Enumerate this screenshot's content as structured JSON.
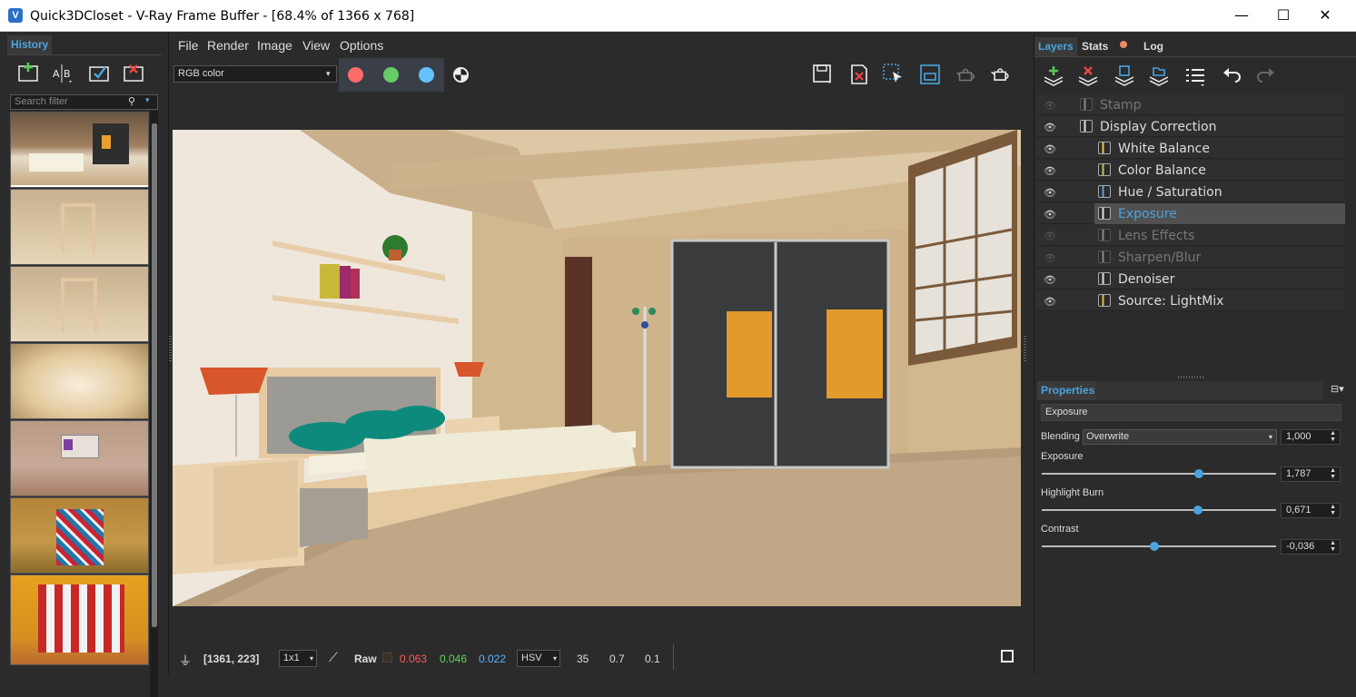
{
  "window": {
    "title": "Quick3DCloset - V-Ray Frame Buffer - [68.4% of 1366 x 768]",
    "app_icon": "V",
    "controls": {
      "minimize": "—",
      "maximize": "☐",
      "close": "✕"
    }
  },
  "history": {
    "tab_label": "History",
    "toolbar_icons": [
      "add-icon",
      "ab-compare-icon",
      "load-icon",
      "remove-icon"
    ],
    "search_placeholder": "Search filter",
    "thumbnails": [
      "bedroom-render",
      "shelf-render-1",
      "shelf-render-2",
      "empty-room-render",
      "wall-render",
      "patterned-wardrobe-render",
      "striped-wardrobe-render"
    ]
  },
  "menu": {
    "items": [
      "File",
      "Render",
      "Image",
      "View",
      "Options"
    ]
  },
  "toolbar": {
    "channel": "RGB color",
    "channel_colors": {
      "red": "#ff6b6b",
      "green": "#66cc66",
      "blue": "#66c2ff"
    },
    "right_icons": [
      "save-icon",
      "clear-icon",
      "region-render-icon",
      "track-mouse-icon",
      "render-last-icon",
      "render-icon"
    ]
  },
  "status": {
    "coords": "[1361, 223]",
    "zoom_select": "1x1",
    "raw_label": "Raw",
    "r": "0.063",
    "g": "0.046",
    "b": "0.022",
    "colorspace": "HSV",
    "h": "35",
    "s": "0.7",
    "v": "0.1"
  },
  "layers_panel": {
    "tabs": [
      "Layers",
      "Stats",
      "Log"
    ],
    "layers": [
      {
        "name": "Stamp",
        "enabled": false,
        "indent": 0
      },
      {
        "name": "Display Correction",
        "enabled": true,
        "indent": 0
      },
      {
        "name": "White Balance",
        "enabled": true,
        "indent": 1
      },
      {
        "name": "Color Balance",
        "enabled": true,
        "indent": 1
      },
      {
        "name": "Hue / Saturation",
        "enabled": true,
        "indent": 1
      },
      {
        "name": "Exposure",
        "enabled": true,
        "indent": 1,
        "selected": true
      },
      {
        "name": "Lens Effects",
        "enabled": false,
        "indent": 1
      },
      {
        "name": "Sharpen/Blur",
        "enabled": false,
        "indent": 1
      },
      {
        "name": "Denoiser",
        "enabled": true,
        "indent": 1
      },
      {
        "name": "Source: LightMix",
        "enabled": true,
        "indent": 1
      }
    ]
  },
  "properties": {
    "tab_label": "Properties",
    "layer_name": "Exposure",
    "blending_label": "Blending",
    "blending_mode": "Overwrite",
    "blending_amount": "1,000",
    "exposure_label": "Exposure",
    "exposure_value": "1,787",
    "exposure_slider": 0.67,
    "highlight_label": "Highlight Burn",
    "highlight_value": "0,671",
    "highlight_slider": 0.666,
    "contrast_label": "Contrast",
    "contrast_value": "-0,036",
    "contrast_slider": 0.48
  }
}
